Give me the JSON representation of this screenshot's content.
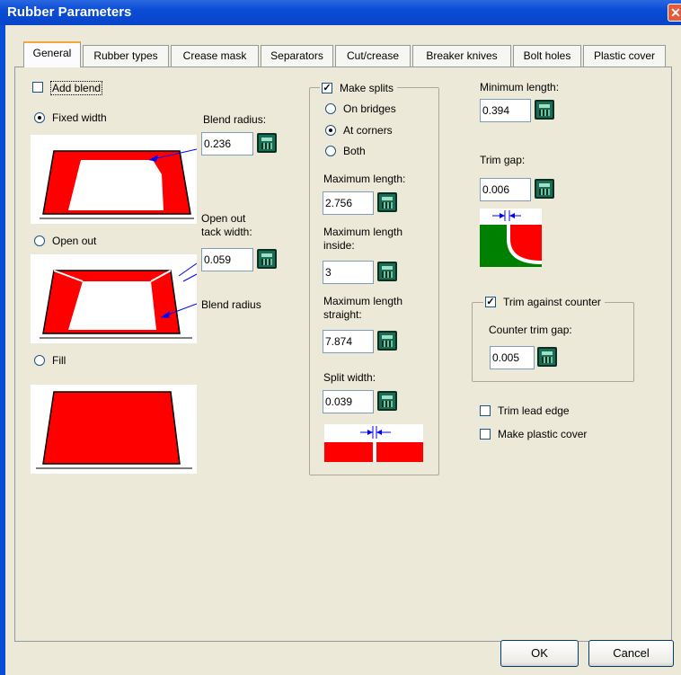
{
  "window": {
    "title": "Rubber Parameters"
  },
  "tabs": [
    "General",
    "Rubber types",
    "Crease mask",
    "Separators",
    "Cut/crease",
    "Breaker knives",
    "Bolt holes",
    "Plastic cover"
  ],
  "left": {
    "add_blend": "Add blend",
    "add_blend_checked": false,
    "fixed_width": "Fixed width",
    "open_out": "Open out",
    "fill": "Fill",
    "selected": "Fixed width",
    "blend_radius_label": "Blend radius:",
    "blend_radius_value": "0.236",
    "open_out_label_1": "Open out",
    "open_out_label_2": "tack width:",
    "open_out_value": "0.059",
    "blend_radius_text": "Blend radius"
  },
  "splits": {
    "make_splits": "Make splits",
    "make_splits_checked": true,
    "on_bridges": "On bridges",
    "at_corners": "At corners",
    "both": "Both",
    "selected": "At corners",
    "max_length_label": "Maximum length:",
    "max_length_value": "2.756",
    "max_inside_label_1": "Maximum length",
    "max_inside_label_2": "inside:",
    "max_inside_value": "3",
    "max_straight_label_1": "Maximum length",
    "max_straight_label_2": "straight:",
    "max_straight_value": "7.874",
    "split_width_label": "Split width:",
    "split_width_value": "0.039"
  },
  "right": {
    "min_length_label": "Minimum length:",
    "min_length_value": "0.394",
    "trim_gap_label": "Trim gap:",
    "trim_gap_value": "0.006",
    "trim_against_counter": "Trim against counter",
    "trim_against_counter_checked": true,
    "counter_trim_gap_label": "Counter trim gap:",
    "counter_trim_gap_value": "0.005",
    "trim_lead_edge": "Trim lead edge",
    "make_plastic_cover": "Make plastic cover"
  },
  "buttons": {
    "ok": "OK",
    "cancel": "Cancel"
  },
  "colors": {
    "rubber": "#ff0000",
    "counter": "#008000",
    "arrow": "#0000ff",
    "titlebar": "#0a4cd6"
  }
}
